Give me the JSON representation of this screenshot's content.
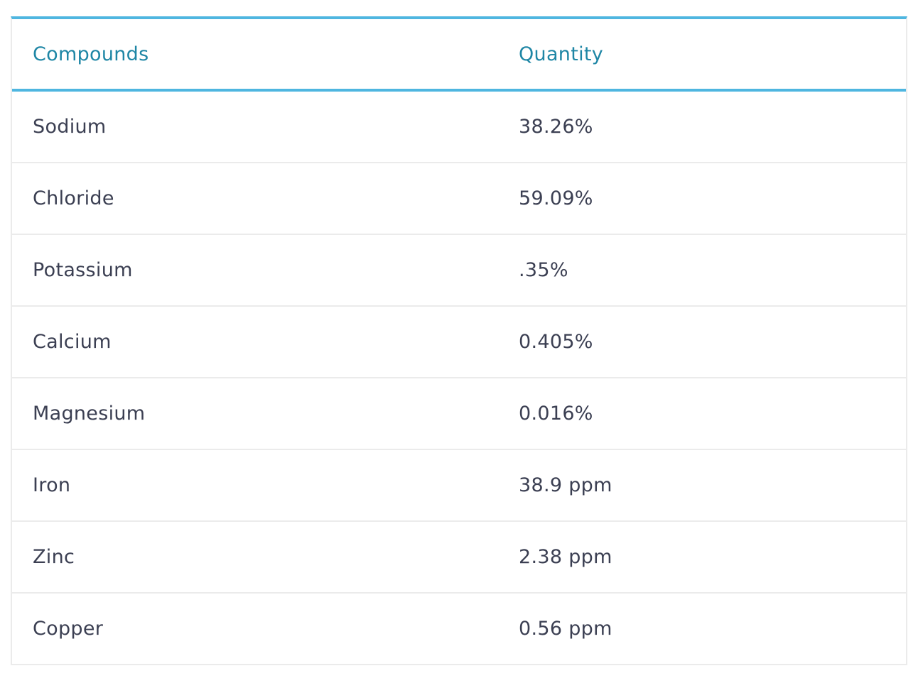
{
  "table": {
    "headers": [
      "Compounds",
      "Quantity"
    ],
    "rows": [
      [
        "Sodium",
        "38.26%"
      ],
      [
        "Chloride",
        "59.09%"
      ],
      [
        "Potassium",
        ".35%"
      ],
      [
        "Calcium",
        "0.405%"
      ],
      [
        "Magnesium",
        "0.016%"
      ],
      [
        "Iron",
        "38.9 ppm"
      ],
      [
        "Zinc",
        "2.38 ppm"
      ],
      [
        "Copper",
        "0.56 ppm"
      ]
    ]
  },
  "colors": {
    "accent": "#4fb6e0",
    "header_text": "#1e86a5",
    "body_text": "#3b3f52",
    "divider": "#ebebeb"
  }
}
